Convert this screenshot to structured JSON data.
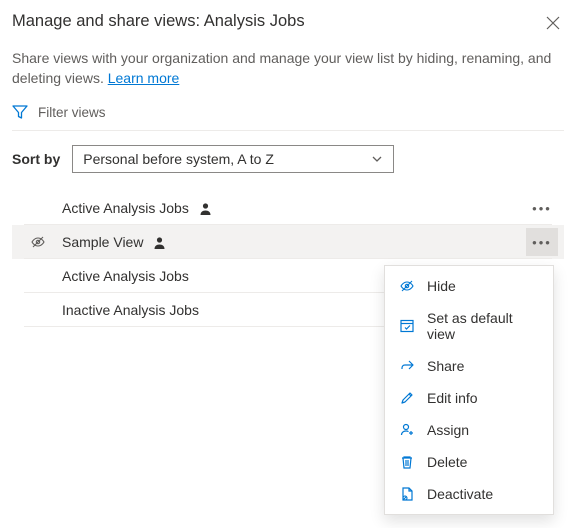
{
  "header": {
    "title": "Manage and share views: Analysis Jobs"
  },
  "description": {
    "text": "Share views with your organization and manage your view list by hiding, renaming, and deleting views. ",
    "link_text": "Learn more"
  },
  "filter": {
    "label": "Filter views"
  },
  "sort": {
    "label": "Sort by",
    "selected": "Personal before system, A to Z"
  },
  "views": [
    {
      "name": "Active Analysis Jobs",
      "personal": true,
      "hidden": false,
      "show_more": true,
      "selected": false
    },
    {
      "name": "Sample View",
      "personal": true,
      "hidden": true,
      "show_more": true,
      "selected": true
    },
    {
      "name": "Active Analysis Jobs",
      "personal": false,
      "hidden": false,
      "show_more": false,
      "selected": false
    },
    {
      "name": "Inactive Analysis Jobs",
      "personal": false,
      "hidden": false,
      "show_more": false,
      "selected": false
    }
  ],
  "context_menu": {
    "items": [
      {
        "key": "hide",
        "label": "Hide"
      },
      {
        "key": "set-default",
        "label": "Set as default view"
      },
      {
        "key": "share",
        "label": "Share"
      },
      {
        "key": "edit-info",
        "label": "Edit info"
      },
      {
        "key": "assign",
        "label": "Assign"
      },
      {
        "key": "delete",
        "label": "Delete"
      },
      {
        "key": "deactivate",
        "label": "Deactivate"
      }
    ]
  }
}
